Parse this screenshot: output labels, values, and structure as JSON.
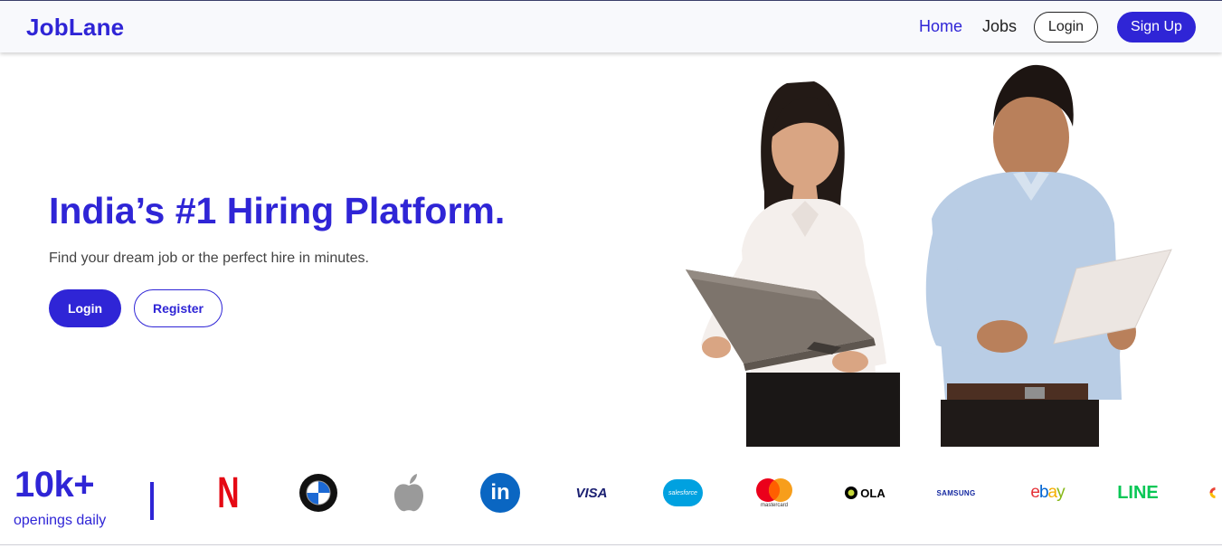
{
  "navbar": {
    "brand": "JobLane",
    "links": [
      "Home",
      "Jobs"
    ],
    "login_label": "Login",
    "signup_label": "Sign Up"
  },
  "hero": {
    "title": "India’s #1 Hiring Platform.",
    "subtitle": "Find your dream job or the perfect hire in minutes.",
    "login_label": "Login",
    "register_label": "Register"
  },
  "stats": {
    "number": "10k+",
    "label": "openings daily"
  },
  "logos": {
    "netflix_letter": "N",
    "linkedin_text": "in",
    "visa_text": "VISA",
    "salesforce_text": "salesforce",
    "mastercard_text": "mastercard",
    "ola_text": "OLA",
    "samsung_text": "SAMSUNG",
    "ebay": [
      "e",
      "b",
      "a",
      "y"
    ],
    "line_text": "LINE"
  },
  "colors": {
    "accent": "#2f25d6",
    "netflix": "#e50914",
    "linkedin": "#0a66c2",
    "visa": "#1a1f71",
    "salesforce": "#00a1e0",
    "mastercard_red": "#eb001b",
    "mastercard_orange": "#f79e1b",
    "line": "#06c755"
  }
}
